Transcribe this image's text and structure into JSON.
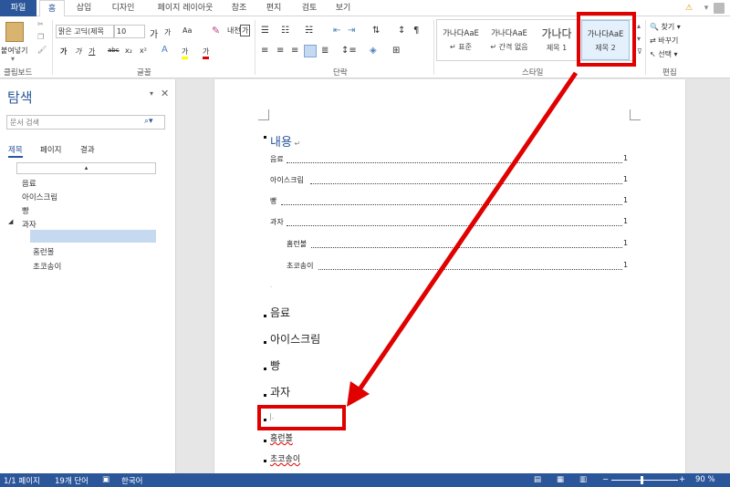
{
  "tabs": {
    "file": "파일",
    "home": "홈",
    "insert": "삽입",
    "design": "디자인",
    "layout": "페이지 레이아웃",
    "references": "참조",
    "mailings": "편지",
    "review": "검토",
    "view": "보기"
  },
  "clipboard": {
    "paste": "붙여넣기",
    "group": "클립보드"
  },
  "font": {
    "name": "맑은 고딕(제목",
    "size": "10",
    "group": "글꼴",
    "grow": "가",
    "shrink": "가",
    "case": "Aa",
    "bold": "가",
    "italic": "가",
    "underline": "가",
    "strike": "abc",
    "sub": "x₂",
    "sup": "x²",
    "highlight": "가",
    "color": "가",
    "phonetic": "내천",
    "enclose": "가"
  },
  "paragraph": {
    "group": "단락"
  },
  "styles": {
    "group": "스타일",
    "items": [
      {
        "sample": "가나다AaE",
        "name": "↵ 표준"
      },
      {
        "sample": "가나다AaE",
        "name": "↵ 간격 없음"
      },
      {
        "sample": "가나다",
        "name": "제목 1"
      },
      {
        "sample": "가나다AaE",
        "name": "제목 2"
      }
    ]
  },
  "editing": {
    "group": "편집",
    "find": "찾기",
    "replace": "바꾸기",
    "select": "선택"
  },
  "nav": {
    "title": "탐색",
    "search_placeholder": "문서 검색",
    "tabs": [
      "제목",
      "페이지",
      "결과"
    ],
    "items": [
      {
        "label": "음료"
      },
      {
        "label": "아이스크림"
      },
      {
        "label": "빵"
      },
      {
        "label": "과자"
      },
      {
        "label": "홈런볼"
      },
      {
        "label": "초코송이"
      }
    ]
  },
  "doc": {
    "toc_title": "내용",
    "toc": [
      {
        "label": "음료",
        "page": "1"
      },
      {
        "label": "아이스크림",
        "page": "1"
      },
      {
        "label": "빵",
        "page": "1"
      },
      {
        "label": "과자",
        "page": "1"
      },
      {
        "label": "홈런볼",
        "page": "1"
      },
      {
        "label": "초코송이",
        "page": "1"
      }
    ],
    "headings": [
      "음료",
      "아이스크림",
      "빵",
      "과자"
    ],
    "subs": [
      "홈런볼",
      "초코송이"
    ]
  },
  "status": {
    "page": "1/1 페이지",
    "words": "19개 단어",
    "lang": "한국어",
    "zoom": "90 %"
  },
  "colors": {
    "accent": "#2b579a",
    "highlight_red": "#e00000"
  }
}
